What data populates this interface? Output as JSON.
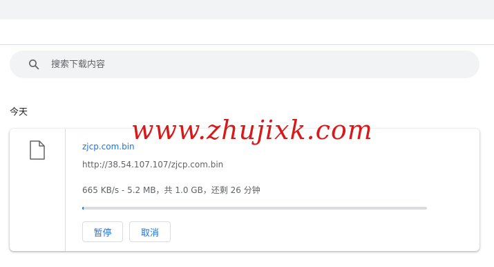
{
  "search": {
    "placeholder": "搜索下载内容",
    "icon": "search-icon"
  },
  "section": {
    "label": "今天"
  },
  "download": {
    "filename": "zjcp.com.bin",
    "url": "http://38.54.107.107/zjcp.com.bin",
    "status": "665 KB/s - 5.2 MB，共 1.0 GB，还剩 26 分钟",
    "progress_fraction": 0.005,
    "file_icon": "file-icon",
    "pause_label": "暂停",
    "cancel_label": "取消"
  },
  "watermark": {
    "text": "www.zhujixk.com"
  },
  "colors": {
    "accent": "#1a73e8",
    "watermark": "#d7191c",
    "track": "#dadce0",
    "surface": "#f1f3f4"
  }
}
